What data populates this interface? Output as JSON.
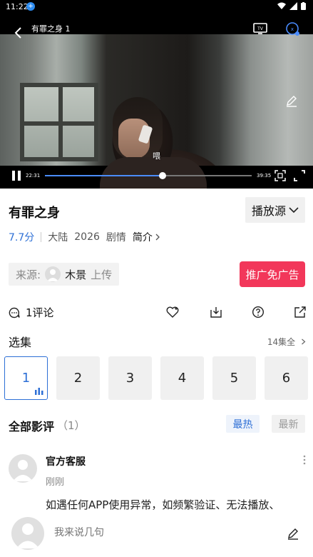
{
  "status_bar": {
    "time": "11:22"
  },
  "player": {
    "title": "有罪之身 1",
    "subtitle": "喂",
    "current_time": "22:31",
    "total_time": "39:35",
    "progress": 0.57
  },
  "info": {
    "title": "有罪之身",
    "source_button": "播放源",
    "score": "7.7分",
    "region": "大陆",
    "year": "2026",
    "genre": "剧情",
    "intro": "简介",
    "source_label": "来源:",
    "uploader": "木景",
    "upload_suffix": "上传",
    "promo_button": "推广免广告"
  },
  "actions": {
    "comments": "1评论"
  },
  "episodes": {
    "heading": "选集",
    "all": "14集全",
    "items": [
      "1",
      "2",
      "3",
      "4",
      "5",
      "6"
    ],
    "active_index": 0
  },
  "reviews": {
    "heading": "全部影评",
    "count": "（1）",
    "sort_hot": "最热",
    "sort_new": "最新",
    "items": [
      {
        "author": "官方客服",
        "time": "刚刚",
        "content": "如遇任何APP使用异常，如频繁验证、无法播放、"
      }
    ]
  },
  "composer": {
    "placeholder": "我来说几句"
  },
  "colors": {
    "accent": "#2d6fd6",
    "promo": "#f2375a"
  }
}
